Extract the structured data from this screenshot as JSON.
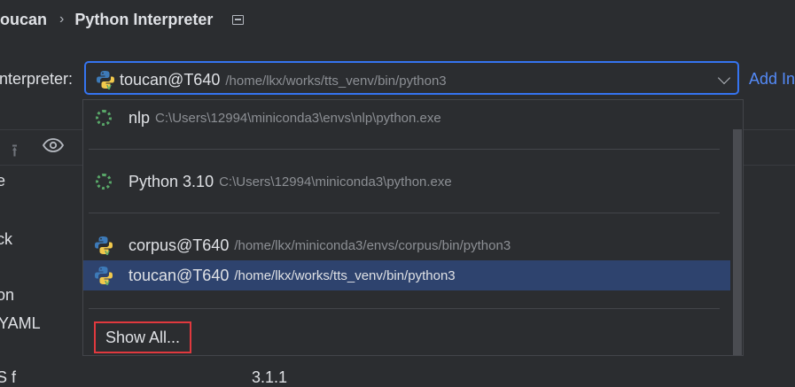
{
  "breadcrumb": {
    "project": "toucan",
    "separator": "›",
    "page": "Python Interpreter"
  },
  "interpreter_label": "Interpreter:",
  "add_link": "Add In",
  "selected": {
    "name": "toucan@T640",
    "path": "/home/lkx/works/tts_venv/bin/python3"
  },
  "background": {
    "header": "e",
    "items": [
      "ck",
      "on",
      "YAML",
      "S f",
      "3.1.1"
    ]
  },
  "options": [
    {
      "name": "nlp",
      "path": "C:\\Users\\12994\\miniconda3\\envs\\nlp\\python.exe",
      "icon": "conda-icon"
    },
    {
      "name": "Python 3.10",
      "path": "C:\\Users\\12994\\miniconda3\\python.exe",
      "icon": "conda-icon"
    },
    {
      "name": "corpus@T640",
      "path": "/home/lkx/miniconda3/envs/corpus/bin/python3",
      "icon": "python-icon"
    },
    {
      "name": "toucan@T640",
      "path": "/home/lkx/works/tts_venv/bin/python3",
      "icon": "python-icon",
      "selected": true
    }
  ],
  "show_all": "Show All...",
  "colors": {
    "accent": "#3574f0",
    "selection": "#2e436e",
    "highlight_box": "#e0393e",
    "conda_green": "#59a869"
  }
}
